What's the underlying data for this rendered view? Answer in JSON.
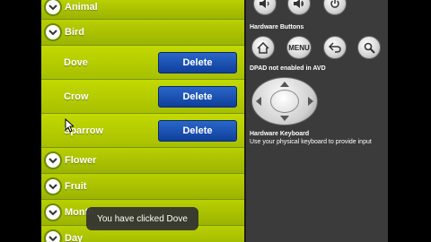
{
  "list": {
    "groups_top": [
      {
        "label": "Animal"
      },
      {
        "label": "Bird"
      }
    ],
    "children": [
      {
        "label": "Dove"
      },
      {
        "label": "Crow"
      },
      {
        "label": "Sparrow"
      }
    ],
    "groups_bottom": [
      {
        "label": "Flower"
      },
      {
        "label": "Fruit"
      },
      {
        "label": "Month"
      },
      {
        "label": "Day"
      }
    ],
    "delete_label": "Delete"
  },
  "toast": "You have clicked Dove",
  "emulator": {
    "hardware_buttons_label": "Hardware Buttons",
    "menu_label": "MENU",
    "dpad_label": "DPAD not enabled in AVD",
    "keyboard_label": "Hardware Keyboard",
    "keyboard_hint": "Use your physical keyboard to provide input"
  },
  "icons": {
    "top_row": [
      "volume-down-icon",
      "volume-up-icon",
      "power-icon"
    ],
    "button_row": [
      "home-icon",
      "menu-button",
      "back-icon",
      "search-icon"
    ]
  },
  "colors": {
    "list_green": "#a7c000",
    "delete_blue": "#1a4fb0",
    "panel_gray": "#3b3b3b"
  }
}
